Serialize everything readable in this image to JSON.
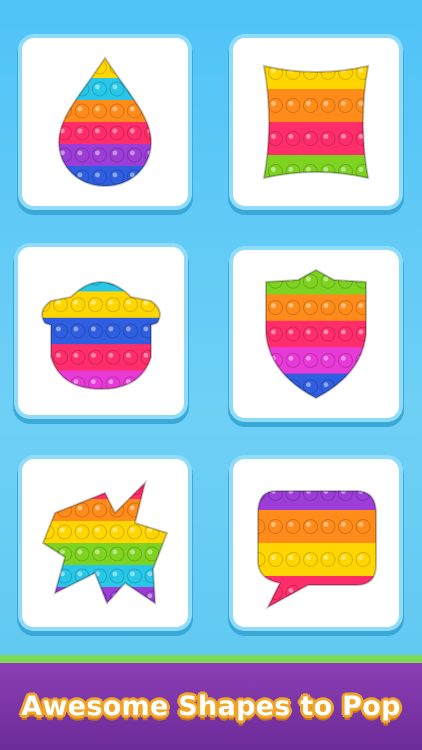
{
  "palette": [
    "#ff2e6a",
    "#ff8c1a",
    "#ffd600",
    "#7ed321",
    "#28c7e8",
    "#2f5fe0",
    "#9b3dd6",
    "#e83ad7"
  ],
  "cards": [
    {
      "shape": "drop-icon",
      "rows": [
        2,
        4,
        1,
        0,
        6,
        5
      ]
    },
    {
      "shape": "square-icon",
      "rows": [
        2,
        1,
        0,
        3
      ]
    },
    {
      "shape": "mushroom-icon",
      "rows": [
        4,
        2,
        5,
        0,
        7
      ]
    },
    {
      "shape": "shield-icon",
      "rows": [
        3,
        1,
        0,
        7,
        5
      ]
    },
    {
      "shape": "pinwheel-icon",
      "rows": [
        0,
        1,
        2,
        3,
        4,
        6
      ]
    },
    {
      "shape": "speech-bubble-icon",
      "rows": [
        6,
        1,
        2,
        0
      ]
    }
  ],
  "banner": {
    "text": "Awesome Shapes to Pop"
  }
}
